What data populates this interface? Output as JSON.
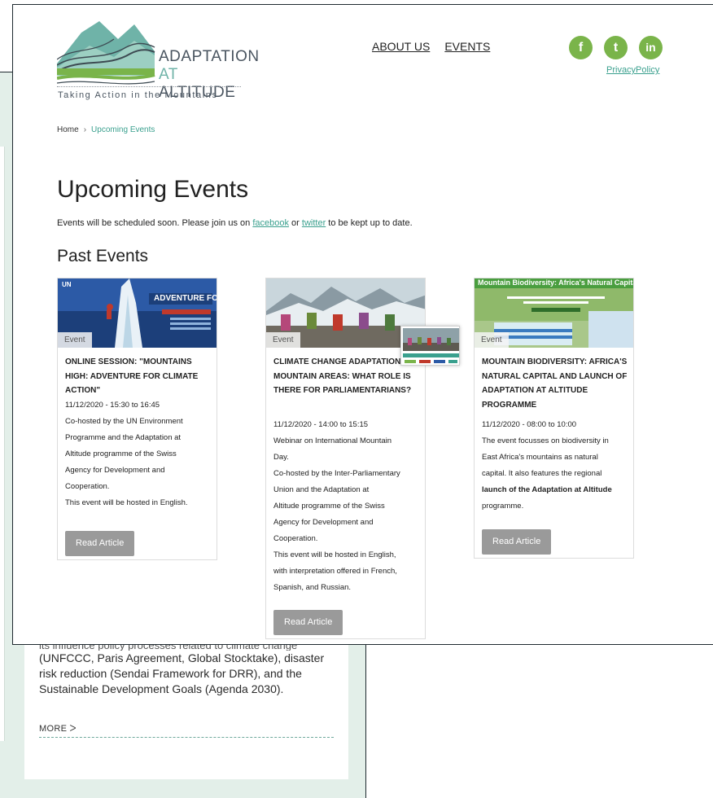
{
  "background": {
    "partial_line": "its influence policy processes related to climate change",
    "paragraph": "(UNFCCC, Paris Agreement, Global Stocktake), disaster risk reduction (Sendai Framework for DRR), and the Sustainable Development Goals (Agenda 2030).",
    "more_label": "MORE ᐳ"
  },
  "logo": {
    "word1": "ADAPTATION",
    "word2_accent": "AT",
    "word2_rest": " ALTITUDE",
    "tagline": "Taking Action in the Mountains"
  },
  "nav": {
    "about": "ABOUT US",
    "events": "EVENTS"
  },
  "social": {
    "facebook_glyph": "f",
    "twitter_glyph": "t",
    "linkedin_glyph": "in",
    "privacy": "PrivacyPolicy",
    "color": "#7ab44a"
  },
  "breadcrumb": {
    "home": "Home",
    "sep": "›",
    "current": "Upcoming Events"
  },
  "page": {
    "title": "Upcoming Events",
    "intro_before": "Events will be scheduled soon. Please join us on ",
    "intro_link1": "facebook",
    "intro_mid": " or ",
    "intro_link2": "twitter",
    "intro_after": " to be kept up to date.",
    "section": "Past Events"
  },
  "cards": [
    {
      "badge": "Event",
      "thumb_caption": "ADVENTURE FOR CLIMATE ACTION",
      "thumb_logo": "UN",
      "title": "ONLINE SESSION: \"MOUNTAINS HIGH: ADVENTURE FOR CLIMATE ACTION\"",
      "date": "11/12/2020 - 15:30 to 16:45",
      "lines": [
        "Co-hosted by the UN Environment",
        "Programme and the Adaptation at",
        "Altitude programme of the Swiss",
        "Agency for Development and",
        "Cooperation.",
        "This event will be hosted in English."
      ],
      "button": "Read Article"
    },
    {
      "badge": "Event",
      "title": "CLIMATE CHANGE ADAPTATION IN MOUNTAIN AREAS: WHAT ROLE IS THERE FOR PARLIAMENTARIANS?",
      "date": "11/12/2020 - 14:00 to 15:15",
      "lines": [
        "Webinar on International Mountain",
        "Day.",
        "Co-hosted by the Inter-Parliamentary",
        "Union and the Adaptation at",
        "Altitude programme of the Swiss",
        "Agency for Development and",
        "Cooperation.",
        "This event will be hosted in English,",
        "with interpretation offered in French,",
        "Spanish, and Russian."
      ],
      "button": "Read Article"
    },
    {
      "badge": "Event",
      "thumb_caption": "Mountain Biodiversity: Africa's Natural Capital",
      "title": "MOUNTAIN BIODIVERSITY: AFRICA'S NATURAL CAPITAL AND LAUNCH OF ADAPTATION AT ALTITUDE PROGRAMME",
      "date": "11/12/2020 - 08:00 to 10:00",
      "lines": [
        "The event focusses on biodiversity in",
        "East Africa's mountains as natural",
        "capital. It also features the regional"
      ],
      "bold_line": "launch of the Adaptation at Altitude",
      "tail_line": "programme.",
      "button": "Read Article"
    }
  ]
}
